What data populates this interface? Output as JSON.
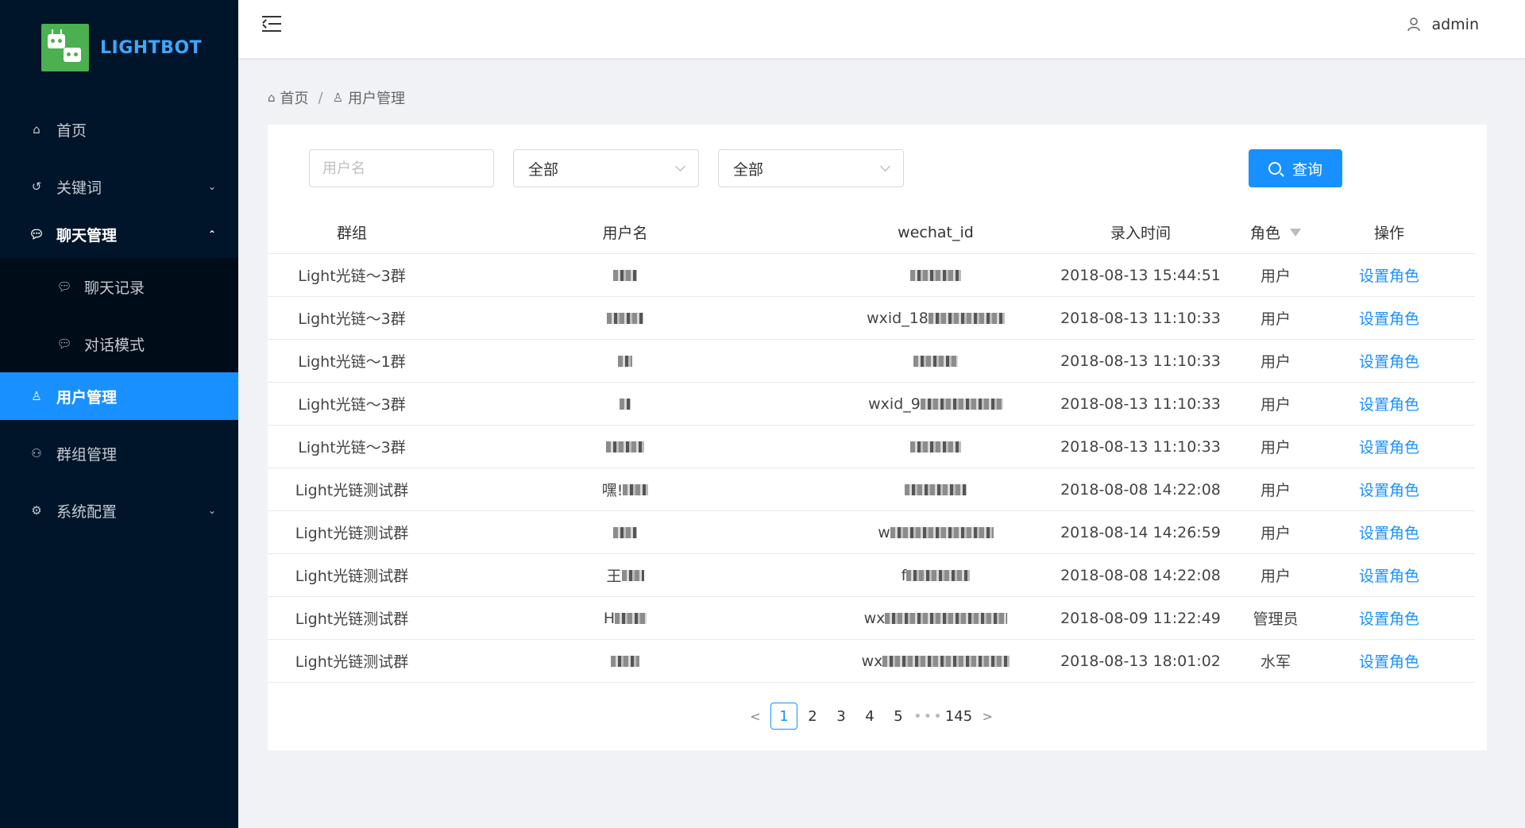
{
  "brand": {
    "name": "LIGHTBOT"
  },
  "sidebar": {
    "items": [
      {
        "label": "首页",
        "icon": "home-icon"
      },
      {
        "label": "关键词",
        "icon": "keyword-icon"
      },
      {
        "label": "聊天管理",
        "icon": "chat-icon"
      },
      {
        "label": "聊天记录",
        "icon": "chat-icon"
      },
      {
        "label": "对话模式",
        "icon": "chat-icon"
      },
      {
        "label": "用户管理",
        "icon": "user-icon"
      },
      {
        "label": "群组管理",
        "icon": "group-icon"
      },
      {
        "label": "系统配置",
        "icon": "gear-icon"
      }
    ]
  },
  "header": {
    "user": "admin"
  },
  "breadcrumb": {
    "home": "首页",
    "current": "用户管理"
  },
  "filters": {
    "username_placeholder": "用户名",
    "select1": "全部",
    "select2": "全部",
    "search_label": "查询"
  },
  "table": {
    "columns": [
      "群组",
      "用户名",
      "wechat_id",
      "录入时间",
      "角色",
      "操作"
    ],
    "rows": [
      {
        "group": "Light光链～3群",
        "user": "",
        "wx": "",
        "time": "2018-08-13 15:44:51",
        "role": "用户",
        "op": "设置角色"
      },
      {
        "group": "Light光链～3群",
        "user": "",
        "wx": "wxid_18",
        "time": "2018-08-13 11:10:33",
        "role": "用户",
        "op": "设置角色"
      },
      {
        "group": "Light光链～1群",
        "user": "",
        "wx": "",
        "time": "2018-08-13 11:10:33",
        "role": "用户",
        "op": "设置角色"
      },
      {
        "group": "Light光链～3群",
        "user": "",
        "wx": "wxid_9",
        "time": "2018-08-13 11:10:33",
        "role": "用户",
        "op": "设置角色"
      },
      {
        "group": "Light光链～3群",
        "user": "",
        "wx": "",
        "time": "2018-08-13 11:10:33",
        "role": "用户",
        "op": "设置角色"
      },
      {
        "group": "Light光链测试群",
        "user": "嘿!",
        "wx": "",
        "time": "2018-08-08 14:22:08",
        "role": "用户",
        "op": "设置角色"
      },
      {
        "group": "Light光链测试群",
        "user": "",
        "wx": "w",
        "time": "2018-08-14 14:26:59",
        "role": "用户",
        "op": "设置角色"
      },
      {
        "group": "Light光链测试群",
        "user": "王",
        "wx": "f",
        "time": "2018-08-08 14:22:08",
        "role": "用户",
        "op": "设置角色"
      },
      {
        "group": "Light光链测试群",
        "user": "H",
        "wx": "wx",
        "time": "2018-08-09 11:22:49",
        "role": "管理员",
        "op": "设置角色"
      },
      {
        "group": "Light光链测试群",
        "user": "",
        "wx": "wx",
        "time": "2018-08-13 18:01:02",
        "role": "水军",
        "op": "设置角色"
      }
    ]
  },
  "pagination": {
    "prev": "<",
    "pages": [
      "1",
      "2",
      "3",
      "4",
      "5"
    ],
    "ellipsis": "•••",
    "last": "145",
    "next": ">",
    "current": "1"
  },
  "colors": {
    "sidebar_bg": "#001529",
    "accent": "#1890ff",
    "logo_green": "#4caf50"
  }
}
